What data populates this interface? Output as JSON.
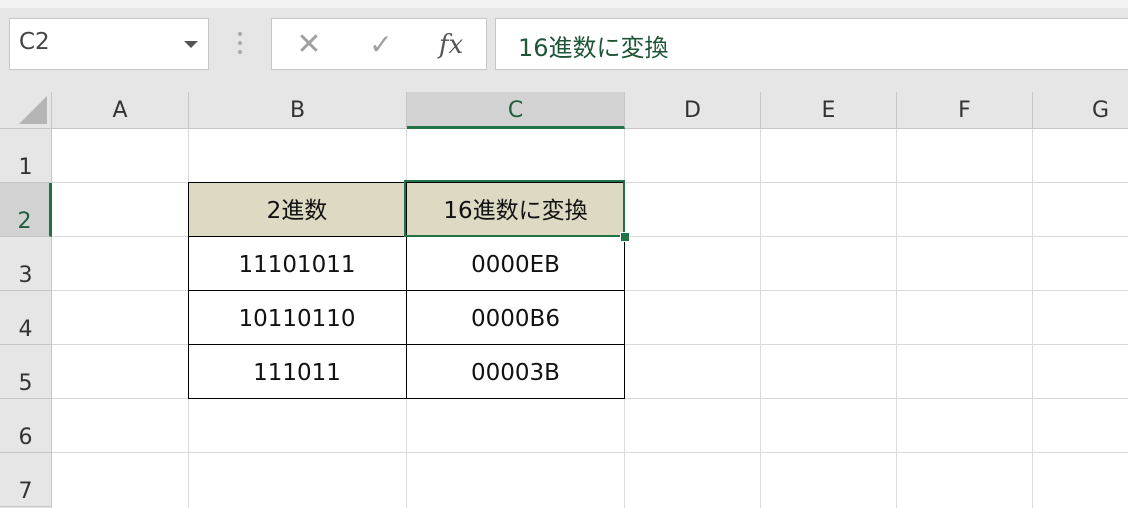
{
  "formula_bar": {
    "name_box": "C2",
    "insert_function_label": "fx",
    "cancel_symbol": "✕",
    "enter_symbol": "✓",
    "formula": "16進数に変換"
  },
  "columns": [
    "A",
    "B",
    "C",
    "D",
    "E",
    "F",
    "G"
  ],
  "rows": [
    "1",
    "2",
    "3",
    "4",
    "5",
    "6",
    "7"
  ],
  "table": {
    "headers": [
      "2進数",
      "16進数に変換"
    ],
    "rows": [
      [
        "11101011",
        "0000EB"
      ],
      [
        "10110110",
        "0000B6"
      ],
      [
        "111011",
        "00003B"
      ]
    ]
  },
  "colors": {
    "header_fill": "#ddd9c3",
    "selection": "#217346"
  }
}
